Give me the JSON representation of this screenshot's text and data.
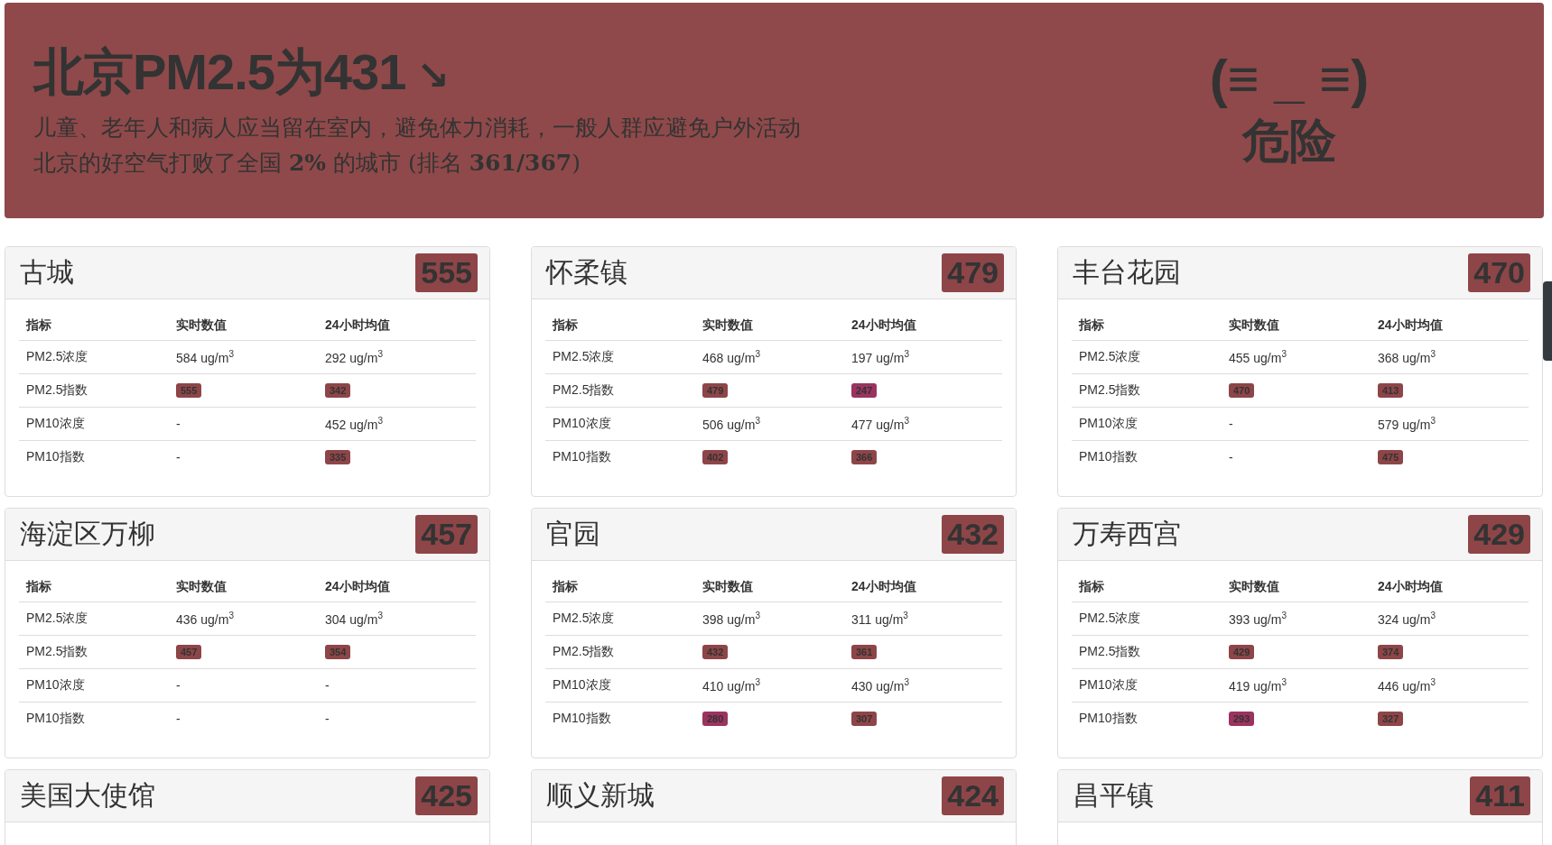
{
  "banner": {
    "title": "北京PM2.5为431",
    "trend": "↘",
    "advice": "儿童、老年人和病人应当留在室内，避免体力消耗，一般人群应避免户外活动",
    "ranking": "北京的好空气打败了全国 **2%** 的城市 (排名 **361/367**)",
    "face": "(≡ _ ≡)",
    "level": "危险"
  },
  "cards": [
    {
      "name": "古城",
      "index": "555",
      "color": "#8e4548",
      "columns": [
        "指标",
        "实时数值",
        "24小时均值"
      ],
      "rows": [
        {
          "cells": [
            {
              "kind": "label",
              "text": "PM2.5浓度"
            },
            {
              "kind": "text",
              "text": "584 ug/m$^{3}$"
            },
            {
              "kind": "text",
              "text": "292 ug/m$^{3}$"
            }
          ]
        },
        {
          "cells": [
            {
              "kind": "label",
              "text": "PM2.5指数"
            },
            {
              "kind": "badge",
              "text": "555",
              "color": "#8e4548"
            },
            {
              "kind": "badge",
              "text": "342",
              "color": "#8e4548"
            }
          ]
        },
        {
          "cells": [
            {
              "kind": "label",
              "text": "PM10浓度"
            },
            {
              "kind": "text",
              "text": "-"
            },
            {
              "kind": "text",
              "text": "452 ug/m$^{3}$"
            }
          ]
        },
        {
          "cells": [
            {
              "kind": "label",
              "text": "PM10指数"
            },
            {
              "kind": "text",
              "text": "-"
            },
            {
              "kind": "badge",
              "text": "335",
              "color": "#8e4548"
            }
          ]
        }
      ]
    },
    {
      "name": "怀柔镇",
      "index": "479",
      "color": "#8e4548",
      "columns": [
        "指标",
        "实时数值",
        "24小时均值"
      ],
      "rows": [
        {
          "cells": [
            {
              "kind": "label",
              "text": "PM2.5浓度"
            },
            {
              "kind": "text",
              "text": "468 ug/m$^{3}$"
            },
            {
              "kind": "text",
              "text": "197 ug/m$^{3}$"
            }
          ]
        },
        {
          "cells": [
            {
              "kind": "label",
              "text": "PM2.5指数"
            },
            {
              "kind": "badge",
              "text": "479",
              "color": "#8e4548"
            },
            {
              "kind": "badge",
              "text": "247",
              "color": "#9b3360"
            }
          ]
        },
        {
          "cells": [
            {
              "kind": "label",
              "text": "PM10浓度"
            },
            {
              "kind": "text",
              "text": "506 ug/m$^{3}$"
            },
            {
              "kind": "text",
              "text": "477 ug/m$^{3}$"
            }
          ]
        },
        {
          "cells": [
            {
              "kind": "label",
              "text": "PM10指数"
            },
            {
              "kind": "badge",
              "text": "402",
              "color": "#8e4548"
            },
            {
              "kind": "badge",
              "text": "366",
              "color": "#8e4548"
            }
          ]
        }
      ]
    },
    {
      "name": "丰台花园",
      "index": "470",
      "color": "#8e4548",
      "columns": [
        "指标",
        "实时数值",
        "24小时均值"
      ],
      "rows": [
        {
          "cells": [
            {
              "kind": "label",
              "text": "PM2.5浓度"
            },
            {
              "kind": "text",
              "text": "455 ug/m$^{3}$"
            },
            {
              "kind": "text",
              "text": "368 ug/m$^{3}$"
            }
          ]
        },
        {
          "cells": [
            {
              "kind": "label",
              "text": "PM2.5指数"
            },
            {
              "kind": "badge",
              "text": "470",
              "color": "#8e4548"
            },
            {
              "kind": "badge",
              "text": "413",
              "color": "#8e4548"
            }
          ]
        },
        {
          "cells": [
            {
              "kind": "label",
              "text": "PM10浓度"
            },
            {
              "kind": "text",
              "text": "-"
            },
            {
              "kind": "text",
              "text": "579 ug/m$^{3}$"
            }
          ]
        },
        {
          "cells": [
            {
              "kind": "label",
              "text": "PM10指数"
            },
            {
              "kind": "text",
              "text": "-"
            },
            {
              "kind": "badge",
              "text": "475",
              "color": "#8e4548"
            }
          ]
        }
      ]
    },
    {
      "name": "海淀区万柳",
      "index": "457",
      "color": "#8e4548",
      "columns": [
        "指标",
        "实时数值",
        "24小时均值"
      ],
      "rows": [
        {
          "cells": [
            {
              "kind": "label",
              "text": "PM2.5浓度"
            },
            {
              "kind": "text",
              "text": "436 ug/m$^{3}$"
            },
            {
              "kind": "text",
              "text": "304 ug/m$^{3}$"
            }
          ]
        },
        {
          "cells": [
            {
              "kind": "label",
              "text": "PM2.5指数"
            },
            {
              "kind": "badge",
              "text": "457",
              "color": "#8e4548"
            },
            {
              "kind": "badge",
              "text": "354",
              "color": "#8e4548"
            }
          ]
        },
        {
          "cells": [
            {
              "kind": "label",
              "text": "PM10浓度"
            },
            {
              "kind": "text",
              "text": "-"
            },
            {
              "kind": "text",
              "text": "-"
            }
          ]
        },
        {
          "cells": [
            {
              "kind": "label",
              "text": "PM10指数"
            },
            {
              "kind": "text",
              "text": "-"
            },
            {
              "kind": "text",
              "text": "-"
            }
          ]
        }
      ]
    },
    {
      "name": "官园",
      "index": "432",
      "color": "#8e4548",
      "columns": [
        "指标",
        "实时数值",
        "24小时均值"
      ],
      "rows": [
        {
          "cells": [
            {
              "kind": "label",
              "text": "PM2.5浓度"
            },
            {
              "kind": "text",
              "text": "398 ug/m$^{3}$"
            },
            {
              "kind": "text",
              "text": "311 ug/m$^{3}$"
            }
          ]
        },
        {
          "cells": [
            {
              "kind": "label",
              "text": "PM2.5指数"
            },
            {
              "kind": "badge",
              "text": "432",
              "color": "#8e4548"
            },
            {
              "kind": "badge",
              "text": "361",
              "color": "#8e4548"
            }
          ]
        },
        {
          "cells": [
            {
              "kind": "label",
              "text": "PM10浓度"
            },
            {
              "kind": "text",
              "text": "410 ug/m$^{3}$"
            },
            {
              "kind": "text",
              "text": "430 ug/m$^{3}$"
            }
          ]
        },
        {
          "cells": [
            {
              "kind": "label",
              "text": "PM10指数"
            },
            {
              "kind": "badge",
              "text": "280",
              "color": "#9b3360"
            },
            {
              "kind": "badge",
              "text": "307",
              "color": "#8e4548"
            }
          ]
        }
      ]
    },
    {
      "name": "万寿西宫",
      "index": "429",
      "color": "#8e4548",
      "columns": [
        "指标",
        "实时数值",
        "24小时均值"
      ],
      "rows": [
        {
          "cells": [
            {
              "kind": "label",
              "text": "PM2.5浓度"
            },
            {
              "kind": "text",
              "text": "393 ug/m$^{3}$"
            },
            {
              "kind": "text",
              "text": "324 ug/m$^{3}$"
            }
          ]
        },
        {
          "cells": [
            {
              "kind": "label",
              "text": "PM2.5指数"
            },
            {
              "kind": "badge",
              "text": "429",
              "color": "#8e4548"
            },
            {
              "kind": "badge",
              "text": "374",
              "color": "#8e4548"
            }
          ]
        },
        {
          "cells": [
            {
              "kind": "label",
              "text": "PM10浓度"
            },
            {
              "kind": "text",
              "text": "419 ug/m$^{3}$"
            },
            {
              "kind": "text",
              "text": "446 ug/m$^{3}$"
            }
          ]
        },
        {
          "cells": [
            {
              "kind": "label",
              "text": "PM10指数"
            },
            {
              "kind": "badge",
              "text": "293",
              "color": "#9b3360"
            },
            {
              "kind": "badge",
              "text": "327",
              "color": "#8e4548"
            }
          ]
        }
      ]
    },
    {
      "name": "美国大使馆",
      "index": "425",
      "color": "#8e4548"
    },
    {
      "name": "顺义新城",
      "index": "424",
      "color": "#8e4548"
    },
    {
      "name": "昌平镇",
      "index": "411",
      "color": "#8e4548"
    }
  ]
}
